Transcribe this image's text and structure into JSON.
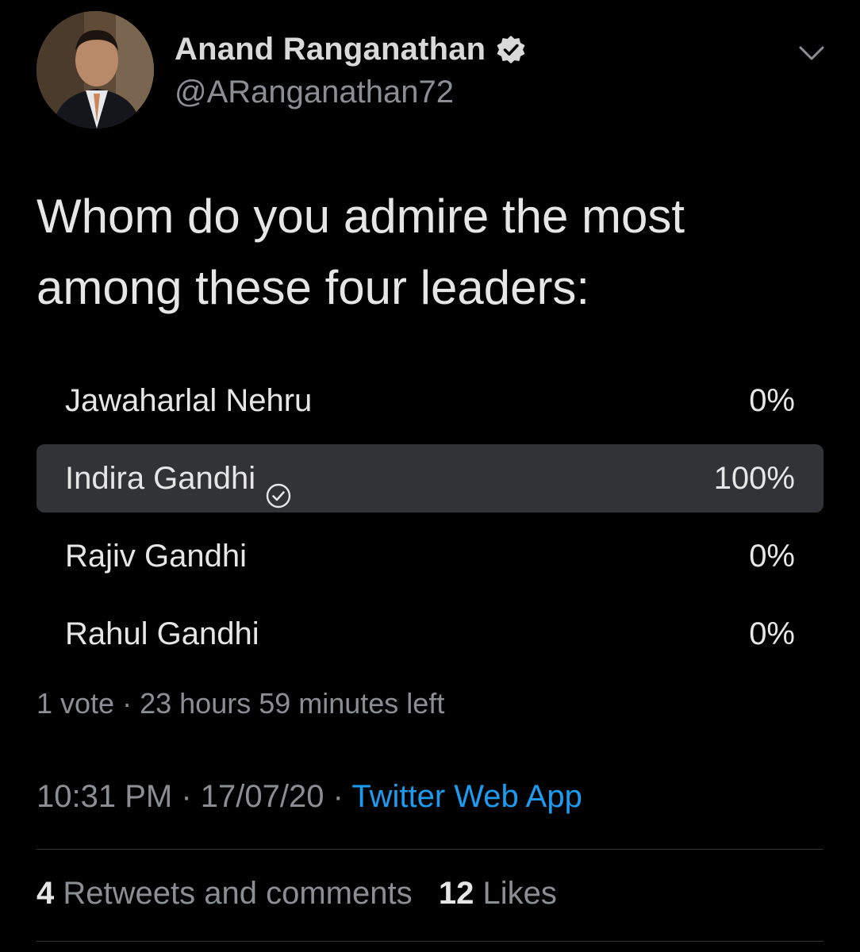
{
  "author": {
    "display_name": "Anand Ranganathan",
    "handle": "@ARanganathan72",
    "verified": true
  },
  "tweet": {
    "text_line1": "Whom do you admire the most",
    "text_line2": "among these four leaders:"
  },
  "poll": {
    "options": [
      {
        "label": "Jawaharlal Nehru",
        "percent_label": "0%",
        "fraction": 0,
        "selected": false
      },
      {
        "label": "Indira Gandhi",
        "percent_label": "100%",
        "fraction": 1,
        "selected": true
      },
      {
        "label": "Rajiv Gandhi",
        "percent_label": "0%",
        "fraction": 0,
        "selected": false
      },
      {
        "label": "Rahul Gandhi",
        "percent_label": "0%",
        "fraction": 0,
        "selected": false
      }
    ],
    "votes": "1 vote",
    "separator": "·",
    "time_left": "23 hours 59 minutes left"
  },
  "meta": {
    "time": "10:31 PM",
    "separator": "·",
    "date": "17/07/20",
    "source": "Twitter Web App"
  },
  "stats": {
    "retweets_count": "4",
    "retweets_label": "Retweets and comments",
    "likes_count": "12",
    "likes_label": "Likes"
  },
  "colors": {
    "background": "#000000",
    "text": "#e6e6e6",
    "muted": "#8b8f94",
    "link": "#1d9bf0",
    "poll_bar": "#323336"
  },
  "icons": {
    "verified": "verified-badge-icon",
    "menu": "chevron-down-icon",
    "selected": "check-circle-icon"
  }
}
